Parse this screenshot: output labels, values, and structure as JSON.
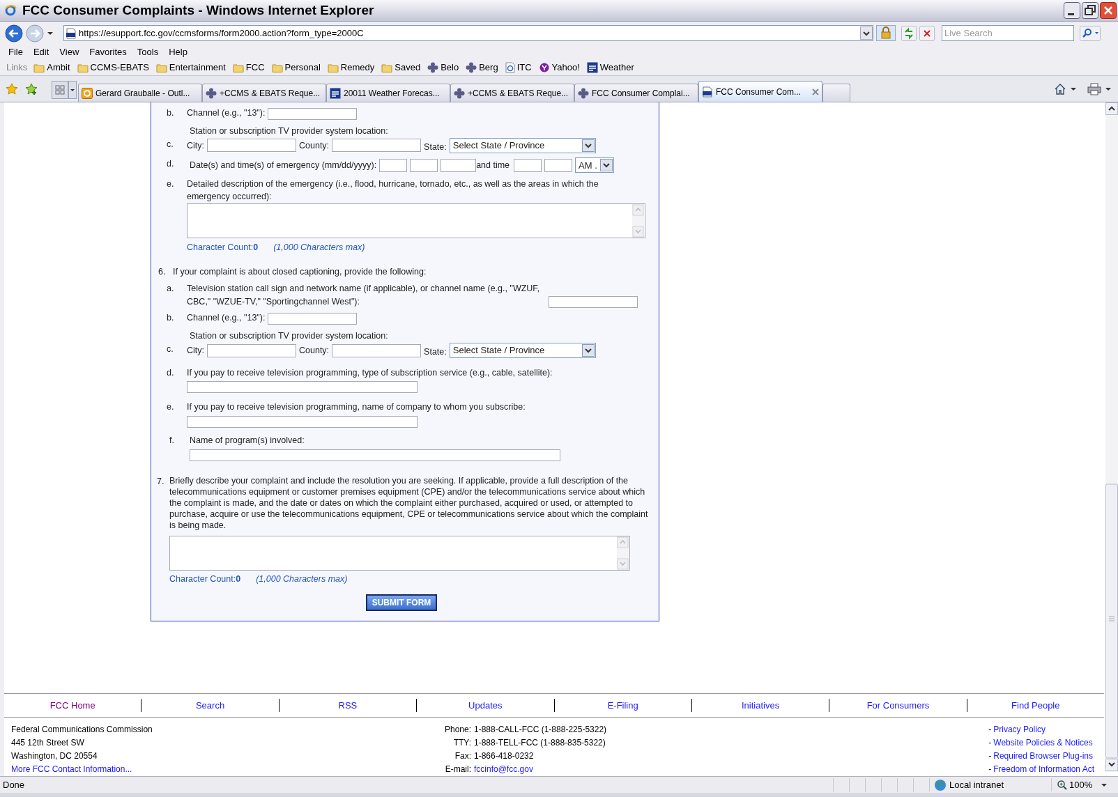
{
  "window": {
    "title": "FCC Consumer Complaints - Windows Internet Explorer"
  },
  "address_bar": {
    "url": "https://esupport.fcc.gov/ccmsforms/form2000.action?form_type=2000C"
  },
  "search": {
    "placeholder": "Live Search"
  },
  "menu": [
    "File",
    "Edit",
    "View",
    "Favorites",
    "Tools",
    "Help"
  ],
  "links_bar": {
    "label": "Links",
    "items": [
      {
        "label": "Ambit",
        "kind": "folder"
      },
      {
        "label": "CCMS-EBATS",
        "kind": "folder"
      },
      {
        "label": "Entertainment",
        "kind": "folder"
      },
      {
        "label": "FCC",
        "kind": "folder"
      },
      {
        "label": "Personal",
        "kind": "folder"
      },
      {
        "label": "Remedy",
        "kind": "folder"
      },
      {
        "label": "Saved",
        "kind": "folder"
      },
      {
        "label": "Belo",
        "kind": "bead"
      },
      {
        "label": "Berg",
        "kind": "bead"
      },
      {
        "label": "ITC",
        "kind": "ie"
      },
      {
        "label": "Yahoo!",
        "kind": "yahoo"
      },
      {
        "label": "Weather",
        "kind": "twc"
      }
    ]
  },
  "tabs": [
    {
      "label": "Gerard Grauballe - Outl...",
      "kind": "outlook",
      "selected": false
    },
    {
      "label": "+CCMS & EBATS Reque...",
      "kind": "bead",
      "selected": false
    },
    {
      "label": "20011 Weather Forecas...",
      "kind": "twc",
      "selected": false
    },
    {
      "label": "+CCMS & EBATS Reque...",
      "kind": "bead",
      "selected": false
    },
    {
      "label": "FCC Consumer Complai...",
      "kind": "bead",
      "selected": false
    },
    {
      "label": "FCC Consumer Com...",
      "kind": "fcc",
      "selected": true
    }
  ],
  "form": {
    "rows": [
      {
        "kind": "field",
        "letter": "b.",
        "label": "Channel (e.g., \"13\"):"
      },
      {
        "kind": "note",
        "text": "Station or subscription TV provider system location:"
      },
      {
        "kind": "location",
        "letter": "c.",
        "city_label": "City:",
        "county_label": "County:",
        "state_label": "State:",
        "state_value": "Select State / Province"
      },
      {
        "kind": "datetime",
        "letter": "d.",
        "label": "Date(s) and time(s) of emergency (mm/dd/yyyy):",
        "time_label": "and time",
        "ampm": "AM ."
      },
      {
        "kind": "textarea",
        "letter": "e.",
        "label": "Detailed description of the emergency (i.e., flood, hurricane, tornado, etc., as well as the areas in which the emergency occurred):",
        "count_label": "Character Count:",
        "count": "0",
        "max": "(1,000 Characters max)"
      },
      {
        "kind": "question",
        "number": "6.",
        "text": "If your complaint is about closed captioning, provide the following:"
      },
      {
        "kind": "field",
        "letter": "a.",
        "label": "Television station call sign and network name (if applicable), or channel name (e.g., \"WZUF, CBC,\" \"WZUE-TV,\" \"Sportingchannel West\"):"
      },
      {
        "kind": "field",
        "letter": "b.",
        "label": "Channel (e.g., \"13\"):"
      },
      {
        "kind": "note",
        "text": "Station or subscription TV provider system location:"
      },
      {
        "kind": "location",
        "letter": "c.",
        "city_label": "City:",
        "county_label": "County:",
        "state_label": "State:",
        "state_value": "Select State / Province"
      },
      {
        "kind": "line_field",
        "letter": "d.",
        "label": "If you pay to receive television programming, type of subscription service (e.g., cable, satellite):"
      },
      {
        "kind": "line_field",
        "letter": "e.",
        "label": "If you pay to receive television programming, name of company to whom you subscribe:"
      },
      {
        "kind": "long_line_field",
        "letter": "f.",
        "label": "Name of program(s) involved:"
      },
      {
        "kind": "question_textarea",
        "number": "7.",
        "text": "Briefly describe your complaint and include the resolution you are seeking. If applicable, provide a full description of the telecommunications equipment or customer premises equipment (CPE) and/or the telecommunications service about which the complaint is made, and the date or dates on which the complaint either purchased, acquired or used, or attempted to purchase, acquire or use the telecommunications equipment, CPE or telecommunications service about which the complaint is being made.",
        "count_label": "Character Count:",
        "count": "0",
        "max": "(1,000 Characters max)"
      }
    ],
    "submit": "SUBMIT FORM"
  },
  "footer": {
    "nav": [
      {
        "label": "FCC Home",
        "visited": true
      },
      {
        "label": "Search",
        "visited": false
      },
      {
        "label": "RSS",
        "visited": false
      },
      {
        "label": "Updates",
        "visited": false
      },
      {
        "label": "E-Filing",
        "visited": false
      },
      {
        "label": "Initiatives",
        "visited": false
      },
      {
        "label": "For Consumers",
        "visited": false
      },
      {
        "label": "Find People",
        "visited": false
      }
    ],
    "address": [
      "Federal Communications Commission",
      "445 12th Street SW",
      "Washington, DC 20554"
    ],
    "contact_link": "More FCC Contact Information...",
    "contacts": [
      {
        "label": "Phone:",
        "value": "1-888-CALL-FCC (1-888-225-5322)",
        "kind": "text"
      },
      {
        "label": "TTY:",
        "value": "1-888-TELL-FCC (1-888-835-5322)",
        "kind": "text"
      },
      {
        "label": "Fax:",
        "value": "1-866-418-0232",
        "kind": "text"
      },
      {
        "label": "E-mail:",
        "value": "fccinfo@fcc.gov",
        "kind": "link"
      }
    ],
    "policies": [
      {
        "dash": "-",
        "label": "Privacy Policy"
      },
      {
        "dash": "-",
        "label": "Website Policies & Notices"
      },
      {
        "dash": "-",
        "label": "Required Browser Plug-ins"
      },
      {
        "dash": "-",
        "label": "Freedom of Information Act"
      }
    ]
  },
  "status_bar": {
    "text": "Done",
    "zone": "Local intranet",
    "zoom": "100%"
  }
}
